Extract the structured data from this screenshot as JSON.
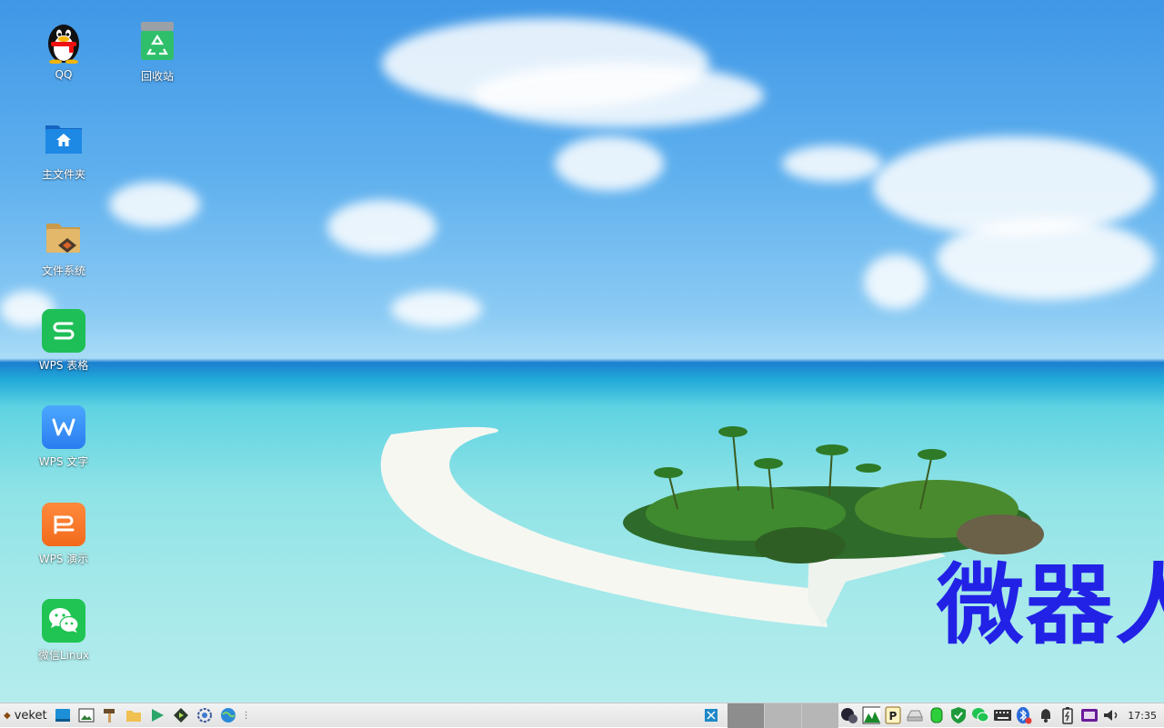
{
  "desktop": {
    "icons": [
      {
        "id": "qq",
        "label": "QQ"
      },
      {
        "id": "recycle",
        "label": "回收站"
      },
      {
        "id": "home",
        "label": "主文件夹"
      },
      {
        "id": "filesystem",
        "label": "文件系统"
      },
      {
        "id": "wps-sheet",
        "label": "WPS 表格"
      },
      {
        "id": "wps-writer",
        "label": "WPS 文字"
      },
      {
        "id": "wps-present",
        "label": "WPS 演示"
      },
      {
        "id": "wechat",
        "label": "微信Linux"
      }
    ],
    "watermark": "微器人"
  },
  "taskbar": {
    "start_label": "veket",
    "quick_launch": [
      "desktop-icon",
      "image-viewer-icon",
      "hammer-icon",
      "folder-icon",
      "play-icon",
      "media-icon",
      "settings-icon",
      "browser-icon",
      "more-icon"
    ],
    "tray": [
      "window-icon",
      "network-icon",
      "monitor-icon",
      "parking-icon",
      "drive-icon",
      "storage-icon",
      "shield-icon",
      "wechat-icon",
      "keyboard-icon",
      "bluetooth-icon",
      "bell-icon",
      "battery-icon",
      "input-method-icon",
      "volume-icon"
    ],
    "clock": "17:35",
    "colors": {
      "task_active": "#8d8d8d",
      "task_inactive": "#b6b6b6",
      "watermark": "#2222e6"
    }
  }
}
